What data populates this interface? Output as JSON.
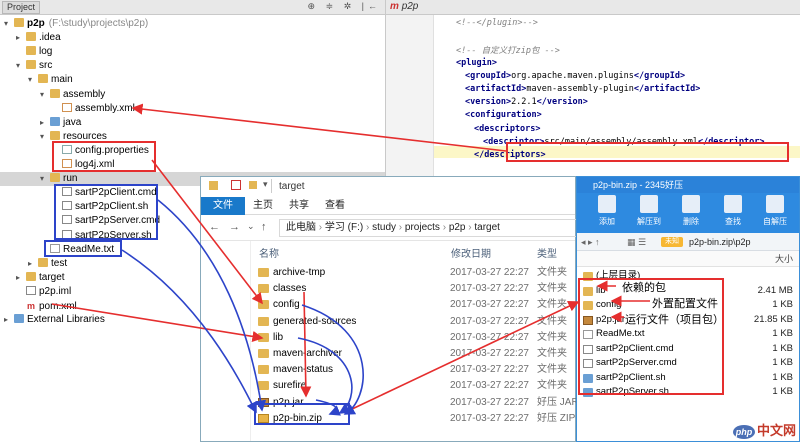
{
  "ide": {
    "panel_tab": "Project",
    "header_icons": "⊕ ≑ ✲ |←",
    "tree": [
      {
        "depth": 0,
        "arrow": "▾",
        "icon": "folder",
        "label": "p2p",
        "hint": "(F:\\study\\projects\\p2p)"
      },
      {
        "depth": 1,
        "arrow": "▸",
        "icon": "folder",
        "label": ".idea"
      },
      {
        "depth": 1,
        "arrow": "",
        "icon": "folder",
        "label": "log"
      },
      {
        "depth": 1,
        "arrow": "▾",
        "icon": "folder",
        "label": "src"
      },
      {
        "depth": 2,
        "arrow": "▾",
        "icon": "folder",
        "label": "main"
      },
      {
        "depth": 3,
        "arrow": "▾",
        "icon": "folder",
        "label": "assembly"
      },
      {
        "depth": 4,
        "arrow": "",
        "icon": "xml",
        "label": "assembly.xml"
      },
      {
        "depth": 3,
        "arrow": "▸",
        "icon": "folder-blue",
        "label": "java"
      },
      {
        "depth": 3,
        "arrow": "▾",
        "icon": "folder",
        "label": "resources"
      },
      {
        "depth": 4,
        "arrow": "",
        "icon": "prop",
        "label": "config.properties"
      },
      {
        "depth": 4,
        "arrow": "",
        "icon": "xml",
        "label": "log4j.xml"
      },
      {
        "depth": 3,
        "arrow": "▾",
        "icon": "folder",
        "label": "run",
        "selected": true
      },
      {
        "depth": 4,
        "arrow": "",
        "icon": "cmd",
        "label": "sartP2pClient.cmd"
      },
      {
        "depth": 4,
        "arrow": "",
        "icon": "cmd",
        "label": "sartP2pClient.sh"
      },
      {
        "depth": 4,
        "arrow": "",
        "icon": "cmd",
        "label": "sartP2pServer.cmd"
      },
      {
        "depth": 4,
        "arrow": "",
        "icon": "cmd",
        "label": "sartP2pServer.sh"
      },
      {
        "depth": 3,
        "arrow": "",
        "icon": "txt",
        "label": "ReadMe.txt"
      },
      {
        "depth": 2,
        "arrow": "▸",
        "icon": "folder",
        "label": "test"
      },
      {
        "depth": 1,
        "arrow": "▸",
        "icon": "folder",
        "label": "target"
      },
      {
        "depth": 1,
        "arrow": "",
        "icon": "iml",
        "label": "p2p.iml"
      },
      {
        "depth": 1,
        "arrow": "",
        "icon": "m",
        "label": "pom.xml"
      },
      {
        "depth": 0,
        "arrow": "▸",
        "icon": "lib",
        "label": "External Libraries"
      }
    ]
  },
  "editor": {
    "tab_label": "p2p",
    "lines": [
      {
        "indent": 2,
        "kind": "cm",
        "text": "<!--</plugin>-->"
      },
      {
        "indent": 0,
        "kind": "tx",
        "text": ""
      },
      {
        "indent": 2,
        "kind": "cm",
        "text": "<!-- 自定义打zip包 -->"
      },
      {
        "indent": 2,
        "kind": "tag",
        "text": "<plugin>"
      },
      {
        "indent": 3,
        "kind": "mix",
        "open": "<groupId>",
        "val": "org.apache.maven.plugins",
        "close": "</groupId>"
      },
      {
        "indent": 3,
        "kind": "mix",
        "open": "<artifactId>",
        "val": "maven-assembly-plugin",
        "close": "</artifactId>"
      },
      {
        "indent": 3,
        "kind": "mix",
        "open": "<version>",
        "val": "2.2.1",
        "close": "</version>"
      },
      {
        "indent": 3,
        "kind": "tag",
        "text": "<configuration>"
      },
      {
        "indent": 4,
        "kind": "tag",
        "text": "<descriptors>"
      },
      {
        "indent": 5,
        "kind": "mix",
        "open": "<descriptor>",
        "val": "src/main/assembly/assembly.xml",
        "close": "</descriptor>"
      },
      {
        "indent": 4,
        "kind": "tag",
        "text": "</descriptors>"
      }
    ]
  },
  "explorer": {
    "title": "target",
    "ribbon": {
      "file": "文件",
      "home": "主页",
      "share": "共享",
      "view": "查看"
    },
    "nav": {
      "back": "←",
      "forward": "→",
      "dropdown": "⌄",
      "up": "↑"
    },
    "address": [
      "此电脑",
      "学习 (F:)",
      "study",
      "projects",
      "p2p",
      "target"
    ],
    "columns": {
      "name": "名称",
      "date": "修改日期",
      "type": "类型"
    },
    "items": [
      {
        "name": "archive-tmp",
        "icon": "folder",
        "date": "2017-03-27 22:27",
        "type": "文件夹"
      },
      {
        "name": "classes",
        "icon": "folder",
        "date": "2017-03-27 22:27",
        "type": "文件夹"
      },
      {
        "name": "config",
        "icon": "folder",
        "date": "2017-03-27 22:27",
        "type": "文件夹"
      },
      {
        "name": "generated-sources",
        "icon": "folder",
        "date": "2017-03-27 22:27",
        "type": "文件夹"
      },
      {
        "name": "lib",
        "icon": "folder",
        "date": "2017-03-27 22:27",
        "type": "文件夹"
      },
      {
        "name": "maven-archiver",
        "icon": "folder",
        "date": "2017-03-27 22:27",
        "type": "文件夹"
      },
      {
        "name": "maven-status",
        "icon": "folder",
        "date": "2017-03-27 22:27",
        "type": "文件夹"
      },
      {
        "name": "surefire",
        "icon": "folder",
        "date": "2017-03-27 22:27",
        "type": "文件夹"
      },
      {
        "name": "p2p.jar",
        "icon": "jar",
        "date": "2017-03-27 22:27",
        "type": "好压 JAR"
      },
      {
        "name": "p2p-bin.zip",
        "icon": "zip",
        "date": "2017-03-27 22:27",
        "type": "好压 ZIP"
      }
    ]
  },
  "zip": {
    "title": "p2p-bin.zip - 2345好压",
    "tools": [
      "添加",
      "解压到",
      "删除",
      "查找",
      "自解压"
    ],
    "unknown_badge": "未知",
    "path": "p2p-bin.zip\\p2p",
    "size_header": "大小",
    "parent": "(上层目录)",
    "items": [
      {
        "name": "lib",
        "icon": "folder",
        "size": "2.41 MB"
      },
      {
        "name": "config",
        "icon": "folder",
        "size": "1 KB"
      },
      {
        "name": "p2p.jar",
        "icon": "jar",
        "size": "21.85 KB"
      },
      {
        "name": "ReadMe.txt",
        "icon": "txt",
        "size": "1 KB"
      },
      {
        "name": "sartP2pClient.cmd",
        "icon": "cmd",
        "size": "1 KB"
      },
      {
        "name": "sartP2pServer.cmd",
        "icon": "cmd",
        "size": "1 KB"
      },
      {
        "name": "sartP2pClient.sh",
        "icon": "sh",
        "size": "1 KB"
      },
      {
        "name": "sartP2pServer.sh",
        "icon": "sh",
        "size": "1 KB"
      }
    ]
  },
  "annotations": {
    "lib_note": "依赖的包",
    "config_note": "外置配置文件",
    "jar_note": "运行文件（项目包）"
  },
  "watermark": {
    "logo": "php",
    "text": "中文网"
  },
  "colors": {
    "red_annotation": "#e52e2e",
    "blue_annotation": "#2d44c9",
    "ribbon_blue": "#1979ca",
    "zip_blue": "#2b82d9"
  }
}
